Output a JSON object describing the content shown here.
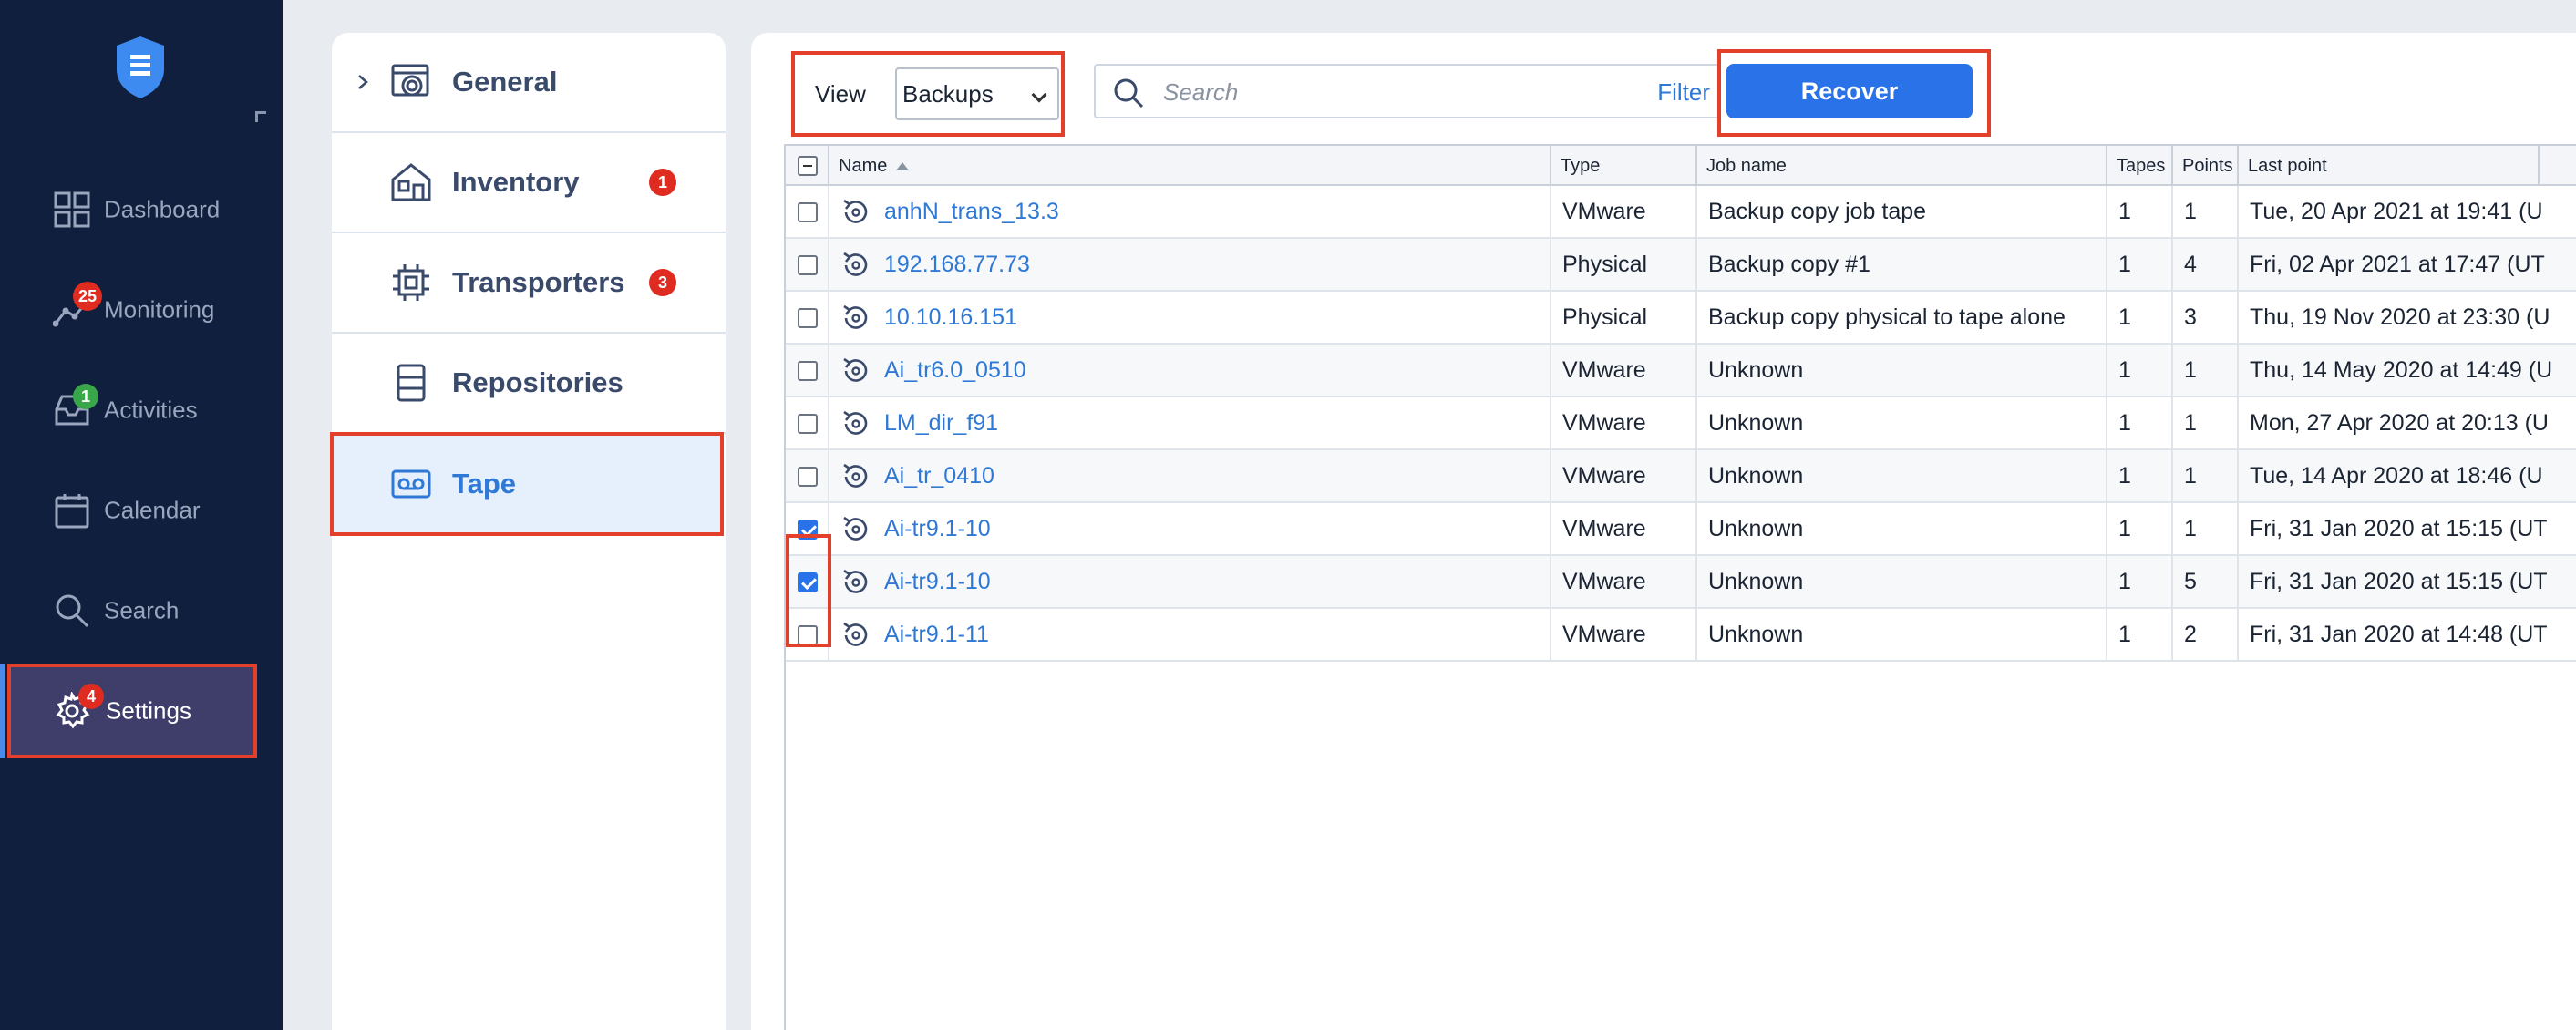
{
  "sidebar": {
    "items": [
      {
        "label": "Dashboard",
        "icon": "dashboard-icon",
        "badge": ""
      },
      {
        "label": "Monitoring",
        "icon": "monitoring-icon",
        "badge": "25"
      },
      {
        "label": "Activities",
        "icon": "activities-icon",
        "badge": "1"
      },
      {
        "label": "Calendar",
        "icon": "calendar-icon",
        "badge": ""
      },
      {
        "label": "Search",
        "icon": "search-icon",
        "badge": ""
      },
      {
        "label": "Settings",
        "icon": "gear-icon",
        "badge": "4"
      }
    ],
    "active": "Settings",
    "colors": {
      "background": "#0f1f3d",
      "active_bg": "#3f3d6a",
      "badge_red": "#e02b20",
      "badge_green": "#3aa64a"
    }
  },
  "settings_menu": {
    "items": [
      {
        "label": "General",
        "badge": ""
      },
      {
        "label": "Inventory",
        "badge": "1"
      },
      {
        "label": "Transporters",
        "badge": "3"
      },
      {
        "label": "Repositories",
        "badge": ""
      },
      {
        "label": "Tape",
        "badge": ""
      }
    ],
    "selected": "Tape"
  },
  "toolbar": {
    "view_label": "View",
    "view_value": "Backups",
    "search_placeholder": "Search",
    "filter_label": "Filter",
    "recover_label": "Recover",
    "accent": "#2a72e8"
  },
  "table": {
    "columns": [
      "Name",
      "Type",
      "Job name",
      "Tapes",
      "Points",
      "Last point"
    ],
    "sort_column": "Name",
    "rows": [
      {
        "name": "anhN_trans_13.3",
        "type": "VMware",
        "job": "Backup copy job tape",
        "tapes": "1",
        "points": "1",
        "last": "Tue, 20 Apr 2021 at 19:41 (U",
        "checked": false
      },
      {
        "name": "192.168.77.73",
        "type": "Physical",
        "job": "Backup copy #1",
        "tapes": "1",
        "points": "4",
        "last": "Fri, 02 Apr 2021 at 17:47 (UT",
        "checked": false
      },
      {
        "name": "10.10.16.151",
        "type": "Physical",
        "job": "Backup copy physical to tape alone",
        "tapes": "1",
        "points": "3",
        "last": "Thu, 19 Nov 2020 at 23:30 (U",
        "checked": false
      },
      {
        "name": "Ai_tr6.0_0510",
        "type": "VMware",
        "job": "Unknown",
        "tapes": "1",
        "points": "1",
        "last": "Thu, 14 May 2020 at 14:49 (U",
        "checked": false
      },
      {
        "name": "LM_dir_f91",
        "type": "VMware",
        "job": "Unknown",
        "tapes": "1",
        "points": "1",
        "last": "Mon, 27 Apr 2020 at 20:13 (U",
        "checked": false
      },
      {
        "name": "Ai_tr_0410",
        "type": "VMware",
        "job": "Unknown",
        "tapes": "1",
        "points": "1",
        "last": "Tue, 14 Apr 2020 at 18:46 (U",
        "checked": false
      },
      {
        "name": "Ai-tr9.1-10",
        "type": "VMware",
        "job": "Unknown",
        "tapes": "1",
        "points": "1",
        "last": "Fri, 31 Jan 2020 at 15:15 (UT",
        "checked": true
      },
      {
        "name": "Ai-tr9.1-10",
        "type": "VMware",
        "job": "Unknown",
        "tapes": "1",
        "points": "5",
        "last": "Fri, 31 Jan 2020 at 15:15 (UT",
        "checked": true
      },
      {
        "name": "Ai-tr9.1-11",
        "type": "VMware",
        "job": "Unknown",
        "tapes": "1",
        "points": "2",
        "last": "Fri, 31 Jan 2020 at 14:48 (UT",
        "checked": false
      }
    ]
  }
}
